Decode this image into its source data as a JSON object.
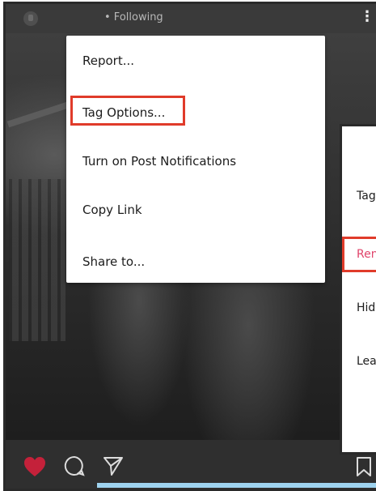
{
  "header": {
    "following_label": "• Following",
    "more_icon": "more-vertical-icon"
  },
  "menu": {
    "items": [
      {
        "label": "Report..."
      },
      {
        "label": "Tag Options..."
      },
      {
        "label": "Turn on Post Notifications"
      },
      {
        "label": "Copy Link"
      },
      {
        "label": "Share to..."
      }
    ],
    "highlight_color": "#e03b2a"
  },
  "secondary_menu": {
    "items": [
      {
        "label": "Tag"
      },
      {
        "label": "Ren"
      },
      {
        "label": "Hid"
      },
      {
        "label": "Lea"
      }
    ],
    "highlight_item_color": "#e0436a"
  },
  "action_bar": {
    "like_icon": "heart-icon",
    "comment_icon": "comment-icon",
    "share_icon": "send-icon",
    "save_icon": "bookmark-icon",
    "like_color": "#c4213a"
  }
}
